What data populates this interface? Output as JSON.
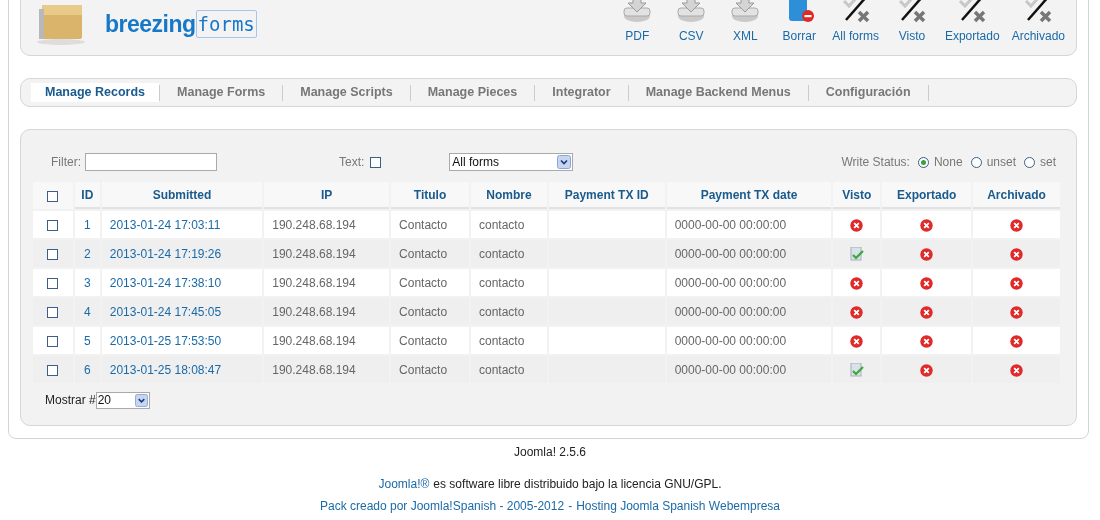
{
  "logo": {
    "bold": "breezing",
    "light": "forms"
  },
  "toolbar": [
    {
      "label": "PDF",
      "kind": "download"
    },
    {
      "label": "CSV",
      "kind": "download"
    },
    {
      "label": "XML",
      "kind": "download"
    },
    {
      "label": "Borrar",
      "kind": "delete"
    },
    {
      "label": "All forms",
      "kind": "toggle"
    },
    {
      "label": "Visto",
      "kind": "toggle"
    },
    {
      "label": "Exportado",
      "kind": "toggle"
    },
    {
      "label": "Archivado",
      "kind": "toggle"
    }
  ],
  "tabs": [
    {
      "label": "Manage Records",
      "selected": true
    },
    {
      "label": "Manage Forms",
      "selected": false
    },
    {
      "label": "Manage Scripts",
      "selected": false
    },
    {
      "label": "Manage Pieces",
      "selected": false
    },
    {
      "label": "Integrator",
      "selected": false
    },
    {
      "label": "Manage Backend Menus",
      "selected": false
    },
    {
      "label": "Configuración",
      "selected": false
    }
  ],
  "filter": {
    "label": "Filter:",
    "text_label": "Text:",
    "text_checked": false,
    "form_select": "All forms",
    "write_status_label": "Write Status:",
    "write_status": [
      {
        "label": "None",
        "selected": true
      },
      {
        "label": "unset",
        "selected": false
      },
      {
        "label": "set",
        "selected": false
      }
    ]
  },
  "table": {
    "select_all_checked": false,
    "columns": [
      "ID",
      "Submitted",
      "IP",
      "Titulo",
      "Nombre",
      "Payment TX ID",
      "Payment TX date",
      "Visto",
      "Exportado",
      "Archivado"
    ],
    "rows": [
      {
        "checked": false,
        "id": "1",
        "submitted": "2013-01-24 17:03:11",
        "ip": "190.248.68.194",
        "titulo": "Contacto",
        "nombre": "contacto",
        "payment_tx_date": "0000-00-00 00:00:00",
        "visto": false,
        "exportado": false,
        "archivado": false
      },
      {
        "checked": false,
        "id": "2",
        "submitted": "2013-01-24 17:19:26",
        "ip": "190.248.68.194",
        "titulo": "Contacto",
        "nombre": "contacto",
        "payment_tx_date": "0000-00-00 00:00:00",
        "visto": true,
        "exportado": false,
        "archivado": false
      },
      {
        "checked": false,
        "id": "3",
        "submitted": "2013-01-24 17:38:10",
        "ip": "190.248.68.194",
        "titulo": "Contacto",
        "nombre": "contacto",
        "payment_tx_date": "0000-00-00 00:00:00",
        "visto": false,
        "exportado": false,
        "archivado": false
      },
      {
        "checked": false,
        "id": "4",
        "submitted": "2013-01-24 17:45:05",
        "ip": "190.248.68.194",
        "titulo": "Contacto",
        "nombre": "contacto",
        "payment_tx_date": "0000-00-00 00:00:00",
        "visto": false,
        "exportado": false,
        "archivado": false
      },
      {
        "checked": false,
        "id": "5",
        "submitted": "2013-01-25 17:53:50",
        "ip": "190.248.68.194",
        "titulo": "Contacto",
        "nombre": "contacto",
        "payment_tx_date": "0000-00-00 00:00:00",
        "visto": false,
        "exportado": false,
        "archivado": false
      },
      {
        "checked": false,
        "id": "6",
        "submitted": "2013-01-25 18:08:47",
        "ip": "190.248.68.194",
        "titulo": "Contacto",
        "nombre": "contacto",
        "payment_tx_date": "0000-00-00 00:00:00",
        "visto": true,
        "exportado": false,
        "archivado": false
      }
    ]
  },
  "pagination": {
    "label": "Mostrar #",
    "value": "20"
  },
  "footer": {
    "version": "Joomla! 2.5.6",
    "license_link": "Joomla!®",
    "license_text": "es software libre distribuido bajo la licencia GNU/GPL.",
    "pack_link": "Pack creado por Joomla!Spanish - 2005-2012",
    "separator": "-",
    "hosting_link": "Hosting Joomla Spanish Webempresa"
  }
}
